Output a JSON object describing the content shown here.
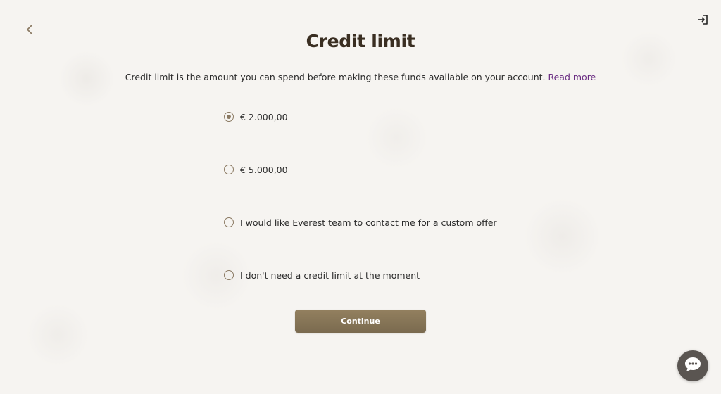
{
  "header": {
    "title": "Credit limit",
    "back_icon": "chevron-left-icon",
    "logout_icon": "logout-icon"
  },
  "description": {
    "text": "Credit limit is the amount you can spend before making these funds available on your account.",
    "link_label": "Read more"
  },
  "options": [
    {
      "label": "€ 2.000,00",
      "selected": true
    },
    {
      "label": "€ 5.000,00",
      "selected": false
    },
    {
      "label": "I would like Everest team to contact me for a custom offer",
      "selected": false
    },
    {
      "label": "I don't need a credit limit at the moment",
      "selected": false
    }
  ],
  "actions": {
    "continue_label": "Continue"
  },
  "chat": {
    "icon": "chat-icon"
  },
  "colors": {
    "accent": "#8b7a63",
    "button": "#85745a",
    "link": "#6a2c82",
    "title": "#3a2e22",
    "chat_bubble": "#5a5551"
  }
}
